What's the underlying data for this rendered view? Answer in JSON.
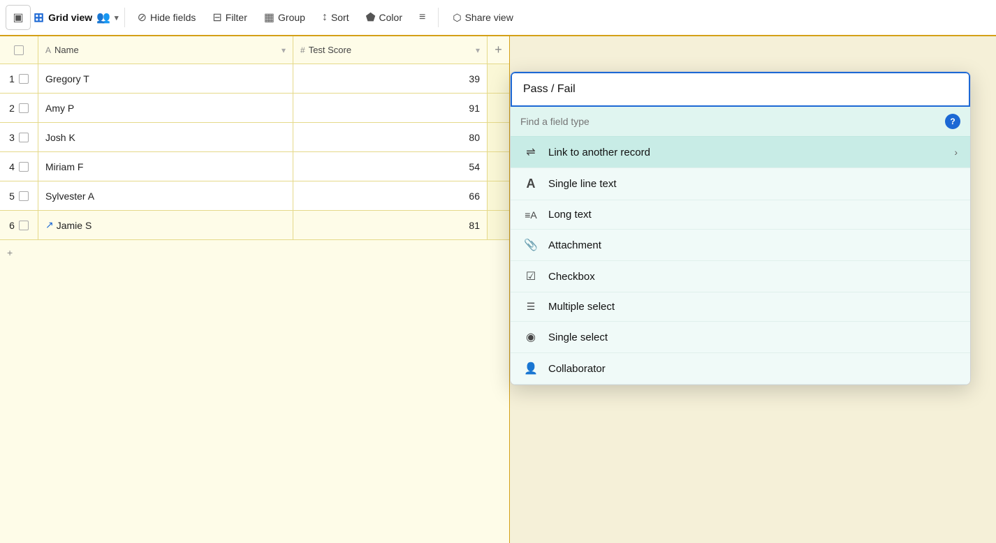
{
  "topbar": {
    "sidebar_toggle_icon": "☰",
    "view_icon": "⊞",
    "view_name": "Grid view",
    "users_icon": "👥",
    "dropdown_arrow": "▾",
    "hide_fields_label": "Hide fields",
    "filter_label": "Filter",
    "group_label": "Group",
    "sort_label": "Sort",
    "color_label": "Color",
    "list_icon": "≡",
    "share_label": "Share view"
  },
  "table": {
    "columns": [
      {
        "id": "check",
        "label": ""
      },
      {
        "id": "name",
        "label": "Name",
        "icon": "A"
      },
      {
        "id": "score",
        "label": "Test Score",
        "icon": "#"
      },
      {
        "id": "add",
        "label": "+"
      }
    ],
    "rows": [
      {
        "id": 1,
        "name": "Gregory T",
        "score": "39",
        "checked": false,
        "expand": false
      },
      {
        "id": 2,
        "name": "Amy P",
        "score": "91",
        "checked": false,
        "expand": false
      },
      {
        "id": 3,
        "name": "Josh K",
        "score": "80",
        "checked": false,
        "expand": false
      },
      {
        "id": 4,
        "name": "Miriam F",
        "score": "54",
        "checked": false,
        "expand": false
      },
      {
        "id": 5,
        "name": "Sylvester A",
        "score": "66",
        "checked": false,
        "expand": false
      },
      {
        "id": 6,
        "name": "Jamie S",
        "score": "81",
        "checked": false,
        "expand": true
      }
    ],
    "add_row_label": "+"
  },
  "dropdown": {
    "field_name_value": "Pass / Fail",
    "field_name_placeholder": "Pass / Fail",
    "search_placeholder": "Find a field type",
    "help_label": "?",
    "field_types": [
      {
        "id": "link",
        "icon": "⇌",
        "label": "Link to another record",
        "has_arrow": true
      },
      {
        "id": "single-line",
        "icon": "A",
        "label": "Single line text",
        "has_arrow": false
      },
      {
        "id": "long-text",
        "icon": "≡A",
        "label": "Long text",
        "has_arrow": false
      },
      {
        "id": "attachment",
        "icon": "📎",
        "label": "Attachment",
        "has_arrow": false
      },
      {
        "id": "checkbox",
        "icon": "☑",
        "label": "Checkbox",
        "has_arrow": false
      },
      {
        "id": "multiple-select",
        "icon": "☰✓",
        "label": "Multiple select",
        "has_arrow": false
      },
      {
        "id": "single-select",
        "icon": "◉",
        "label": "Single select",
        "has_arrow": false
      },
      {
        "id": "collaborator",
        "icon": "👤",
        "label": "Collaborator",
        "has_arrow": false
      }
    ]
  }
}
